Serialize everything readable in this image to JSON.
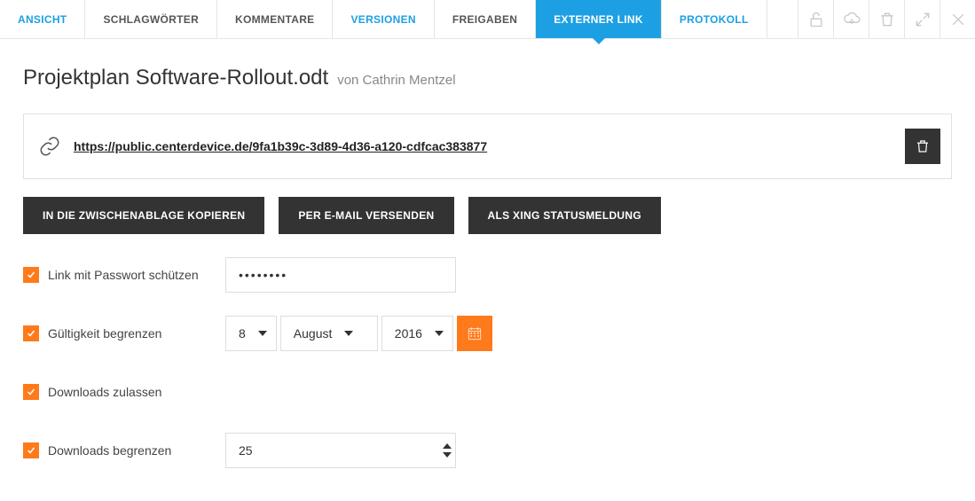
{
  "tabs": [
    {
      "label": "ANSICHT",
      "variant": "link"
    },
    {
      "label": "SCHLAGWÖRTER",
      "variant": "plain"
    },
    {
      "label": "KOMMENTARE",
      "variant": "plain"
    },
    {
      "label": "VERSIONEN",
      "variant": "link"
    },
    {
      "label": "FREIGABEN",
      "variant": "plain"
    },
    {
      "label": "EXTERNER LINK",
      "variant": "active"
    },
    {
      "label": "PROTOKOLL",
      "variant": "link"
    }
  ],
  "title": "Projektplan Software-Rollout.odt",
  "author": "von Cathrin Mentzel",
  "link_url": "https://public.centerdevice.de/9fa1b39c-3d89-4d36-a120-cdfcac383877",
  "actions": {
    "copy": "IN DIE ZWISCHENABLAGE KOPIEREN",
    "email": "PER E-MAIL VERSENDEN",
    "xing": "ALS XING STATUSMELDUNG"
  },
  "options": {
    "password": {
      "label": "Link mit Passwort schützen",
      "value": "••••••••"
    },
    "validity": {
      "label": "Gültigkeit begrenzen",
      "day": "8",
      "month": "August",
      "year": "2016"
    },
    "downloads_allow": {
      "label": "Downloads zulassen"
    },
    "downloads_limit": {
      "label": "Downloads begrenzen",
      "value": "25"
    }
  }
}
